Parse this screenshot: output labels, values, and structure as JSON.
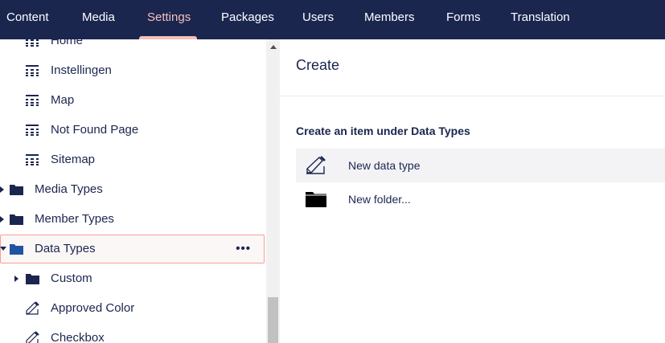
{
  "nav": {
    "items": [
      {
        "label": "Content"
      },
      {
        "label": "Media"
      },
      {
        "label": "Settings",
        "active": true
      },
      {
        "label": "Packages"
      },
      {
        "label": "Users"
      },
      {
        "label": "Members"
      },
      {
        "label": "Forms"
      },
      {
        "label": "Translation"
      }
    ]
  },
  "tree": {
    "items": [
      {
        "label": "Home",
        "icon": "template-icon"
      },
      {
        "label": "Instellingen",
        "icon": "template-icon"
      },
      {
        "label": "Map",
        "icon": "template-icon"
      },
      {
        "label": "Not Found Page",
        "icon": "template-icon"
      },
      {
        "label": "Sitemap",
        "icon": "template-icon"
      },
      {
        "label": "Media Types",
        "icon": "folder-icon",
        "expanded": false
      },
      {
        "label": "Member Types",
        "icon": "folder-icon",
        "expanded": false
      },
      {
        "label": "Data Types",
        "icon": "folder-icon",
        "expanded": true,
        "selected": true,
        "actions": "•••"
      },
      {
        "label": "Custom",
        "icon": "folder-icon",
        "expanded": false
      },
      {
        "label": "Approved Color",
        "icon": "datatype-icon"
      },
      {
        "label": "Checkbox",
        "icon": "datatype-icon"
      }
    ]
  },
  "panel": {
    "title": "Create",
    "subtitle": "Create an item under Data Types",
    "options": [
      {
        "label": "New data type",
        "icon": "datatype-icon"
      },
      {
        "label": "New folder...",
        "icon": "folder-icon"
      }
    ]
  },
  "colors": {
    "header_bg": "#1b264f",
    "active_nav": "#f5c1bc",
    "selection_border": "#f5a097",
    "folder_blue": "#2152a3",
    "text": "#1b264f"
  }
}
